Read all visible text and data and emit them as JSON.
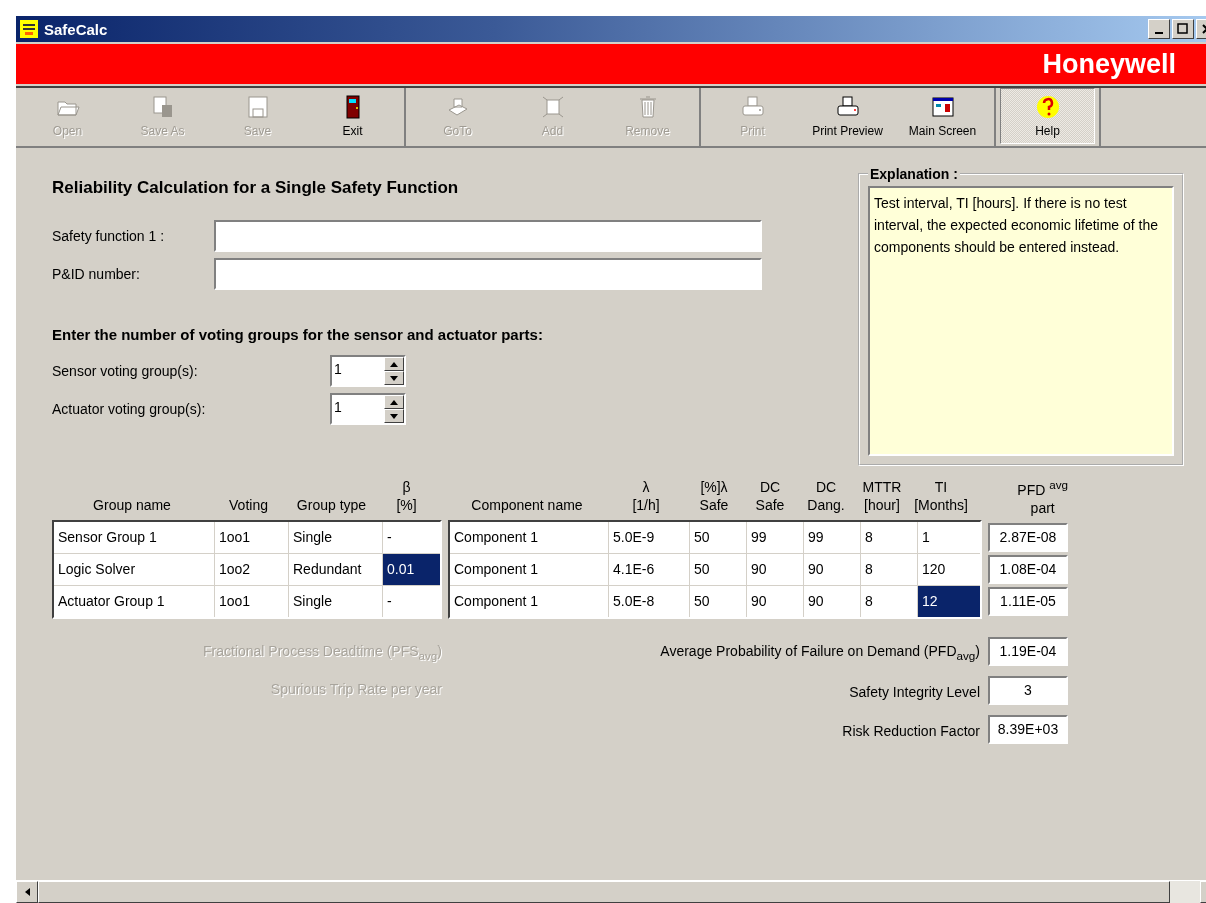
{
  "window": {
    "title": "SafeCalc",
    "brand": "Honeywell"
  },
  "toolbar": [
    {
      "group": [
        {
          "label": "Open",
          "kind": "folder",
          "disabled": true
        },
        {
          "label": "Save As",
          "kind": "saveas",
          "disabled": true
        },
        {
          "label": "Save",
          "kind": "disk",
          "disabled": true
        },
        {
          "label": "Exit",
          "kind": "door",
          "disabled": false
        }
      ]
    },
    {
      "group": [
        {
          "label": "GoTo",
          "kind": "goto",
          "disabled": true
        },
        {
          "label": "Add",
          "kind": "add",
          "disabled": true
        },
        {
          "label": "Remove",
          "kind": "trash",
          "disabled": true
        }
      ]
    },
    {
      "group": [
        {
          "label": "Print",
          "kind": "printer",
          "disabled": true
        },
        {
          "label": "Print Preview",
          "kind": "printer",
          "disabled": false
        },
        {
          "label": "Main Screen",
          "kind": "screen",
          "disabled": false
        }
      ]
    },
    {
      "group": [
        {
          "label": "Help",
          "kind": "help",
          "disabled": false,
          "selected": true
        }
      ]
    }
  ],
  "heading": "Reliability Calculation for a Single Safety Function",
  "fields": [
    {
      "label": "Safety function  1 :"
    },
    {
      "label": "P&ID number:"
    }
  ],
  "voting_heading": "Enter the number of voting groups for the sensor and actuator parts:",
  "spinners": [
    {
      "label": "Sensor voting group(s):",
      "value": "1"
    },
    {
      "label": "Actuator voting group(s):",
      "value": "1"
    }
  ],
  "explanation": {
    "title": "Explanation :",
    "text": "Test interval, TI [hours]. If there is no test interval, the expected economic lifetime of the components should be entered instead."
  },
  "table": {
    "group_columns": [
      "Group name",
      "Voting",
      "Group type",
      "β\n[%]"
    ],
    "component_columns": [
      "Component name",
      "λ\n[1/h]",
      "[%]λ\nSafe",
      "DC\nSafe",
      "DC\nDang.",
      "MTTR\n[hour]",
      "TI\n[Months]"
    ],
    "result_column": "PFD $^{avg}$\npart",
    "rows": [
      {
        "group": [
          {
            "text": "Sensor Group 1",
            "selected": false
          },
          {
            "text": "1oo1",
            "selected": false
          },
          {
            "text": "Single",
            "selected": false
          },
          {
            "text": "-",
            "selected": false
          }
        ],
        "component": [
          {
            "text": "Component 1",
            "selected": false
          },
          {
            "text": "5.0E-9",
            "selected": false
          },
          {
            "text": "50",
            "selected": false
          },
          {
            "text": "99",
            "selected": false
          },
          {
            "text": "99",
            "selected": false
          },
          {
            "text": "8",
            "selected": false
          },
          {
            "text": "1",
            "selected": false
          }
        ],
        "result": "2.87E-08"
      },
      {
        "group": [
          {
            "text": "Logic Solver",
            "selected": false
          },
          {
            "text": "1oo2",
            "selected": false
          },
          {
            "text": "Redundant",
            "selected": false
          },
          {
            "text": "0.01",
            "selected": true
          }
        ],
        "component": [
          {
            "text": "Component 1",
            "selected": false
          },
          {
            "text": "4.1E-6",
            "selected": false
          },
          {
            "text": "50",
            "selected": false
          },
          {
            "text": "90",
            "selected": false
          },
          {
            "text": "90",
            "selected": false
          },
          {
            "text": "8",
            "selected": false
          },
          {
            "text": "120",
            "selected": false
          }
        ],
        "result": "1.08E-04"
      },
      {
        "group": [
          {
            "text": "Actuator Group 1",
            "selected": false
          },
          {
            "text": "1oo1",
            "selected": false
          },
          {
            "text": "Single",
            "selected": false
          },
          {
            "text": "-",
            "selected": false
          }
        ],
        "component": [
          {
            "text": "Component 1",
            "selected": false
          },
          {
            "text": "5.0E-8",
            "selected": false
          },
          {
            "text": "50",
            "selected": false
          },
          {
            "text": "90",
            "selected": false
          },
          {
            "text": "90",
            "selected": false
          },
          {
            "text": "8",
            "selected": false
          },
          {
            "text": "12",
            "selected": true
          }
        ],
        "result": "1.11E-05"
      }
    ]
  },
  "disabled_results": [
    {
      "label": "Fractional Process Deadtime   (PFS$_{avg}$)"
    },
    {
      "label": "Spurious Trip Rate per year"
    }
  ],
  "results": [
    {
      "label": "Average Probability of Failure on Demand (PFD$_{avg}$)",
      "value": "1.19E-04"
    },
    {
      "label": "Safety Integrity Level",
      "value": "3"
    },
    {
      "label": "Risk Reduction Factor",
      "value": "8.39E+03"
    }
  ]
}
